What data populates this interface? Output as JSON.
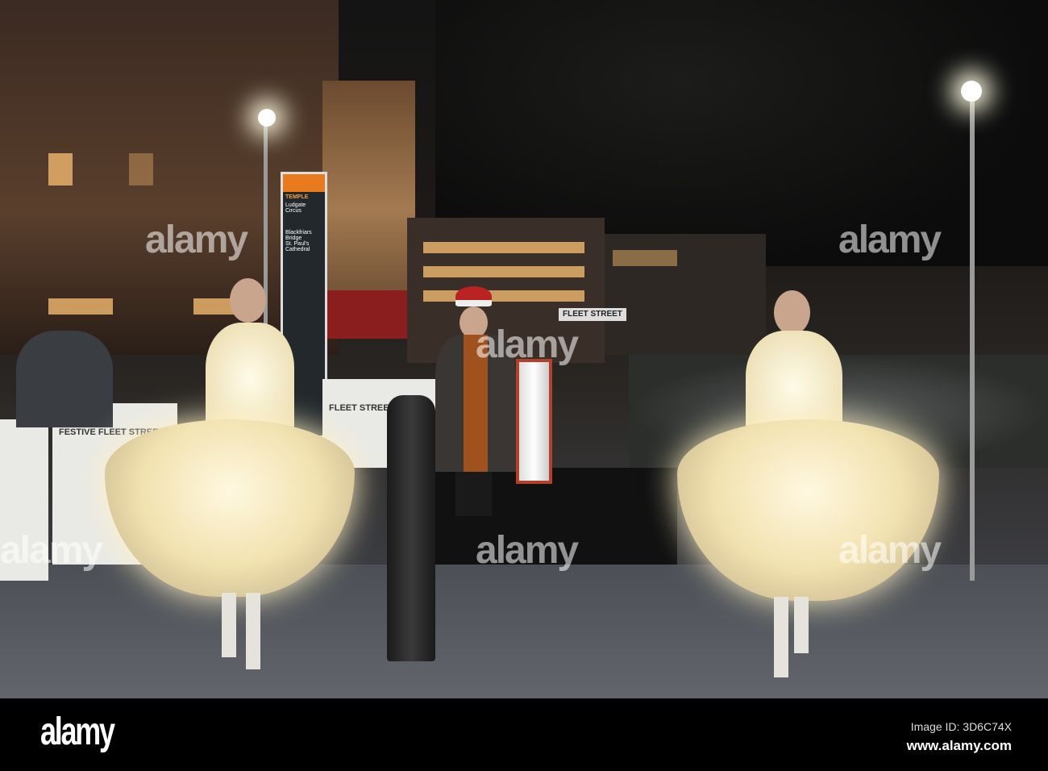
{
  "photo": {
    "sign": {
      "title": "TEMPLE",
      "place": "Ludgate Circus",
      "line1": "Blackfriars Bridge",
      "line2": "St. Paul's Cathedral"
    },
    "street_sign": "FLEET STREET",
    "banner_left": "FESTIVE FLEET STREET",
    "banner_right": "FLEET STREET",
    "watermark": "alamy"
  },
  "footer": {
    "logo": "alamy",
    "image_id": "Image ID: 3D6C74X",
    "website": "www.alamy.com"
  }
}
